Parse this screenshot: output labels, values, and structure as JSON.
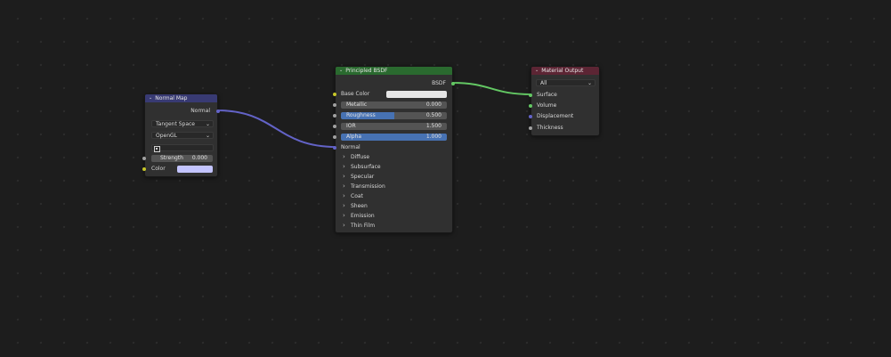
{
  "colors": {
    "normal_map_header": "#383a73",
    "bsdf_header": "#2a6a2f",
    "output_header": "#5c2534",
    "vector_link": "#6363c7",
    "shader_link": "#63c763",
    "normal_color_swatch": "#c3c4ff",
    "base_color_swatch": "#e6e6e6"
  },
  "normal_map": {
    "title": "Normal Map",
    "output": "Normal",
    "space": "Tangent Space",
    "convention": "OpenGL",
    "uv_icon": "uv-map-icon",
    "strength_label": "Strength",
    "strength_value": "0.000",
    "color_label": "Color"
  },
  "bsdf": {
    "title": "Principled BSDF",
    "output": "BSDF",
    "base_color_label": "Base Color",
    "metallic_label": "Metallic",
    "metallic_value": "0.000",
    "roughness_label": "Roughness",
    "roughness_value": "0.500",
    "roughness_fraction": 0.5,
    "ior_label": "IOR",
    "ior_value": "1.500",
    "alpha_label": "Alpha",
    "alpha_value": "1.000",
    "alpha_fraction": 1.0,
    "normal_label": "Normal",
    "panels": [
      "Diffuse",
      "Subsurface",
      "Specular",
      "Transmission",
      "Coat",
      "Sheen",
      "Emission",
      "Thin Film"
    ]
  },
  "output": {
    "title": "Material Output",
    "target": "All",
    "inputs": [
      "Surface",
      "Volume",
      "Displacement",
      "Thickness"
    ]
  }
}
